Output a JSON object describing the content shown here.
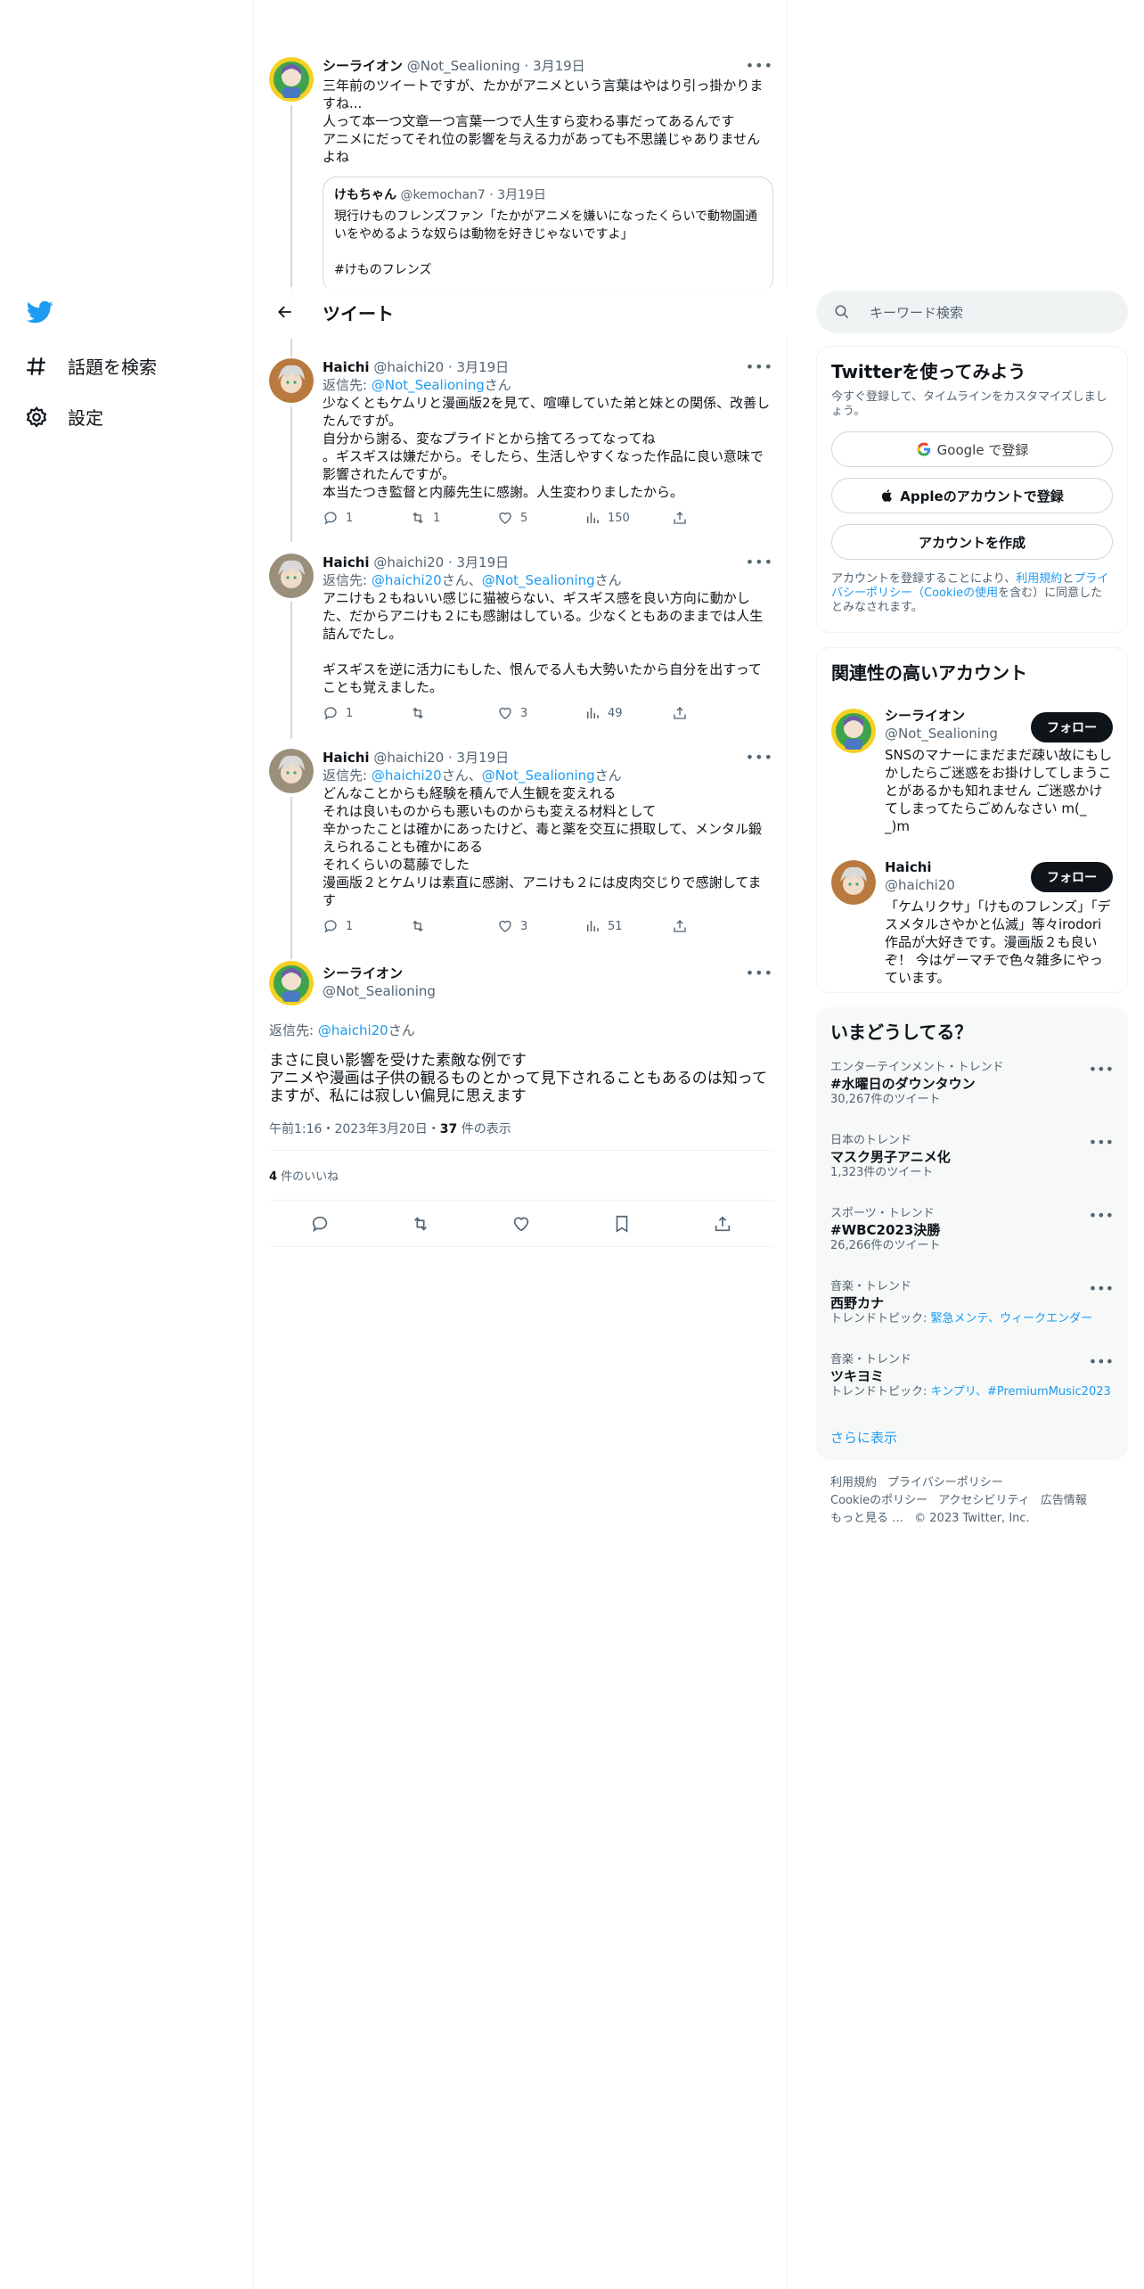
{
  "nav": {
    "explore_label": "話題を検索",
    "settings_label": "設定"
  },
  "header": {
    "title": "ツイート"
  },
  "tweets": [
    {
      "name": "シーライオン",
      "handle": "@Not_Sealioning",
      "date": "· 3月19日",
      "text": "三年前のツイートですが、たかがアニメという言葉はやはり引っ掛かりますね...\n人って本一つ文章一つ言葉一つで人生すら変わる事だってあるんです\nアニメにだってそれ位の影響を与える力があっても不思議じゃありませんよね",
      "quote": {
        "name": "けもちゃん",
        "handle": "@kemochan7",
        "date": "· 3月19日",
        "text": "現行けものフレンズファン「たかがアニメを嫌いになったくらいで動物園通いをやめるような奴らは動物を好きじゃないですよ」\n\n#けものフレンズ"
      }
    },
    {
      "name": "Haichi",
      "handle": "@haichi20",
      "date": "· 3月19日",
      "reply_prefix": "返信先: ",
      "reply_to": "@Not_Sealioning",
      "reply_suffix": "さん",
      "text": "少なくともケムリと漫画版2を見て、喧嘩していた弟と妹との関係、改善したんですが。\n自分から謝る、変なプライドとから捨てろってなってね\n。ギスギスは嫌だから。そしたら、生活しやすくなった作品に良い意味で影響されたんですが。\n本当たつき監督と内藤先生に感謝。人生変わりましたから。",
      "replies": "1",
      "retweets": "1",
      "likes": "5",
      "views": "150"
    },
    {
      "name": "Haichi",
      "handle": "@haichi20",
      "date": "· 3月19日",
      "reply_prefix": "返信先: ",
      "reply_to": "@haichi20",
      "reply_mid": "さん、",
      "reply_to2": "@Not_Sealioning",
      "reply_suffix": "さん",
      "text": "アニけも２もねいい感じに猫被らない、ギスギス感を良い方向に動かした、だからアニけも２にも感謝はしている。少なくともあのままでは人生詰んでたし。\n\nギスギスを逆に活力にもした、恨んでる人も大勢いたから自分を出すってことも覚えました。",
      "replies": "1",
      "retweets": "",
      "likes": "3",
      "views": "49"
    },
    {
      "name": "Haichi",
      "handle": "@haichi20",
      "date": "· 3月19日",
      "reply_prefix": "返信先: ",
      "reply_to": "@haichi20",
      "reply_mid": "さん、",
      "reply_to2": "@Not_Sealioning",
      "reply_suffix": "さん",
      "text": "どんなことからも経験を積んで人生観を変えれる\nそれは良いものからも悪いものからも変える材料として\n辛かったことは確かにあったけど、毒と薬を交互に摂取して、メンタル鍛えられることも確かにある\nそれくらいの葛藤でした\n漫画版２とケムリは素直に感謝、アニけも２には皮肉交じりで感謝してます",
      "replies": "1",
      "retweets": "",
      "likes": "3",
      "views": "51"
    }
  ],
  "main_tweet": {
    "name": "シーライオン",
    "handle": "@Not_Sealioning",
    "reply_prefix": "返信先: ",
    "reply_to": "@haichi20",
    "reply_suffix": "さん",
    "text": "まさに良い影響を受けた素敵な例です\nアニメや漫画は子供の観るものとかって見下されることもあるのは知ってますが、私には寂しい偏見に思えます",
    "time": "午前1:16・2023年3月20日・",
    "views": "37",
    "views_label": " 件の表示",
    "likes": "4",
    "likes_label": " 件のいいね"
  },
  "search": {
    "placeholder": "キーワード検索"
  },
  "signup": {
    "title": "Twitterを使ってみよう",
    "subtitle": "今すぐ登録して、タイムラインをカスタマイズしましょう。",
    "google_label": "Google で登録",
    "apple_label": "Appleのアカウントで登録",
    "create_label": "アカウントを作成",
    "terms_1": "アカウントを登録することにより、",
    "terms_link1": "利用規約",
    "terms_2": "と",
    "terms_link2": "プライバシーポリシー（Cookieの使用",
    "terms_3": "を含む）に同意したとみなされます。"
  },
  "related": {
    "title": "関連性の高いアカウント",
    "accounts": [
      {
        "name": "シーライオン",
        "handle": "@Not_Sealioning",
        "follow": "フォロー",
        "bio": "SNSのマナーにまだまだ疎い故にもしかしたらご迷惑をお掛けしてしまうことがあるかも知れません ご迷惑かけてしまってたらごめんなさい m(_ _)m"
      },
      {
        "name": "Haichi",
        "handle": "@haichi20",
        "follow": "フォロー",
        "bio": "「ケムリクサ」「けものフレンズ」「デスメタルさやかと仏滅」等々irodori作品が大好きです。漫画版２も良いぞ！ 今はゲーマチで色々雑多にやっています。"
      }
    ]
  },
  "trends": {
    "title": "いまどうしてる？",
    "items": [
      {
        "category": "エンターテインメント・トレンド",
        "name": "#水曜日のダウンタウン",
        "count": "30,267件のツイート"
      },
      {
        "category": "日本のトレンド",
        "name": "マスク男子アニメ化",
        "count": "1,323件のツイート"
      },
      {
        "category": "スポーツ・トレンド",
        "name": "#WBC2023決勝",
        "count": "26,266件のツイート"
      },
      {
        "category": "音楽・トレンド",
        "name": "西野カナ",
        "topic_prefix": "トレンドトピック: ",
        "topics": "緊急メンテ、ウィークエンダー"
      },
      {
        "category": "音楽・トレンド",
        "name": "ツキヨミ",
        "topic_prefix": "トレンドトピック: ",
        "topics": "キンプリ、#PremiumMusic2023"
      }
    ],
    "show_more": "さらに表示"
  },
  "footer": {
    "terms": "利用規約",
    "privacy": "プライバシーポリシー",
    "cookie": "Cookieのポリシー",
    "accessibility": "アクセシビリティ",
    "ads": "広告情報",
    "more": "もっと見る …",
    "copyright": "© 2023 Twitter, Inc."
  },
  "colors": {
    "accent": "#1d9bf0",
    "text": "#0f1419",
    "secondary": "#536471",
    "border": "#eff3f4"
  }
}
